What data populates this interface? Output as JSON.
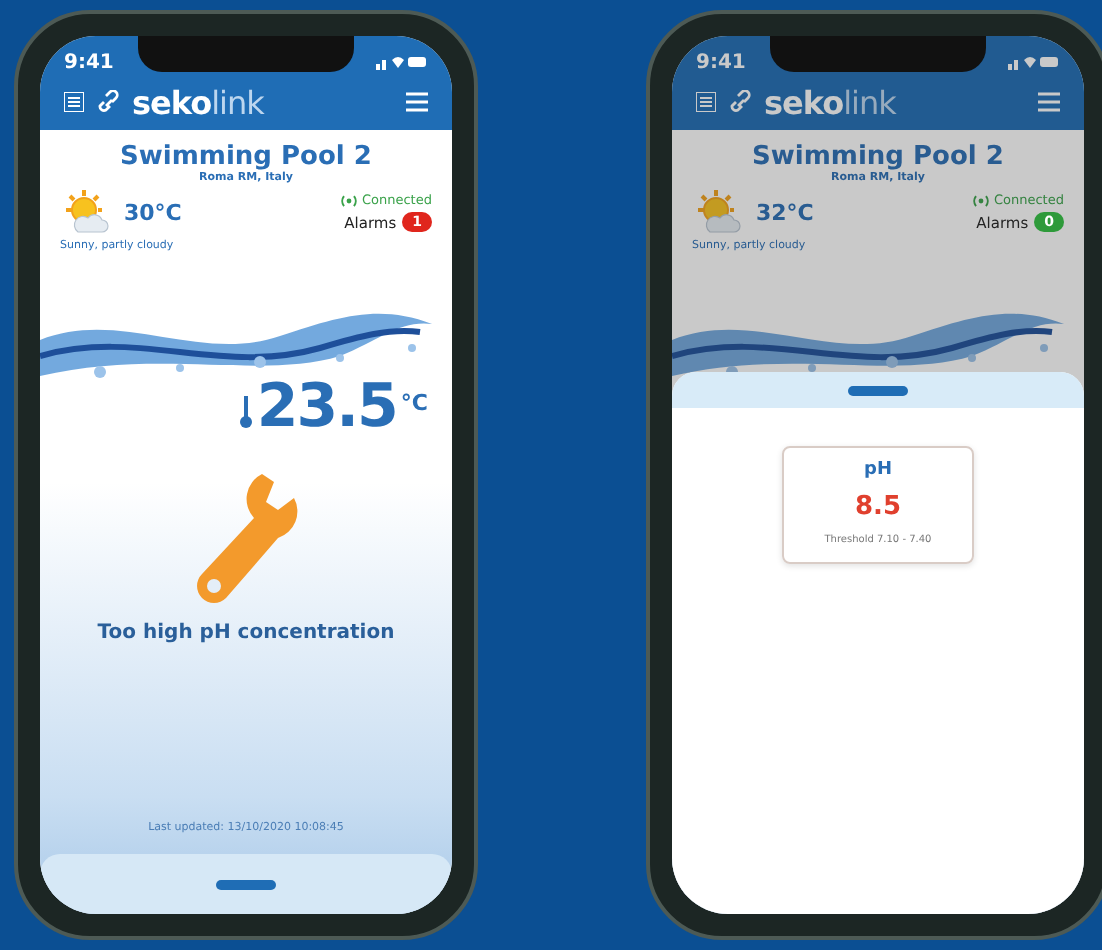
{
  "phones": [
    {
      "kind": "status",
      "time": "9:41",
      "logo": "**seko**link",
      "pool_name": "Swimming Pool 2",
      "location": "Roma RM, Italy",
      "weather": {
        "temperature": "30°C",
        "description": "Sunny, partly cloudy"
      },
      "connection": "Connected",
      "alarms": {
        "label": "Alarms",
        "count": "1",
        "color": "#e0261d"
      },
      "water_temperature": "23.5",
      "water_unit": "°C",
      "message": "Too high pH concentration",
      "last_updated": "Last updated: 13/10/2020 10:08:45"
    },
    {
      "kind": "sheet",
      "time": "9:41",
      "logo": "**seko**link",
      "pool_name": "Swimming Pool 2",
      "location": "Roma RM, Italy",
      "weather": {
        "temperature": "32°C",
        "description": "Sunny, partly cloudy"
      },
      "connection": "Connected",
      "alarms": {
        "label": "Alarms",
        "count": "0",
        "color": "#2e9a3a"
      },
      "sheet": {
        "title": "pH",
        "value": "8.5",
        "threshold": "Threshold 7.10 - 7.40"
      }
    }
  ]
}
